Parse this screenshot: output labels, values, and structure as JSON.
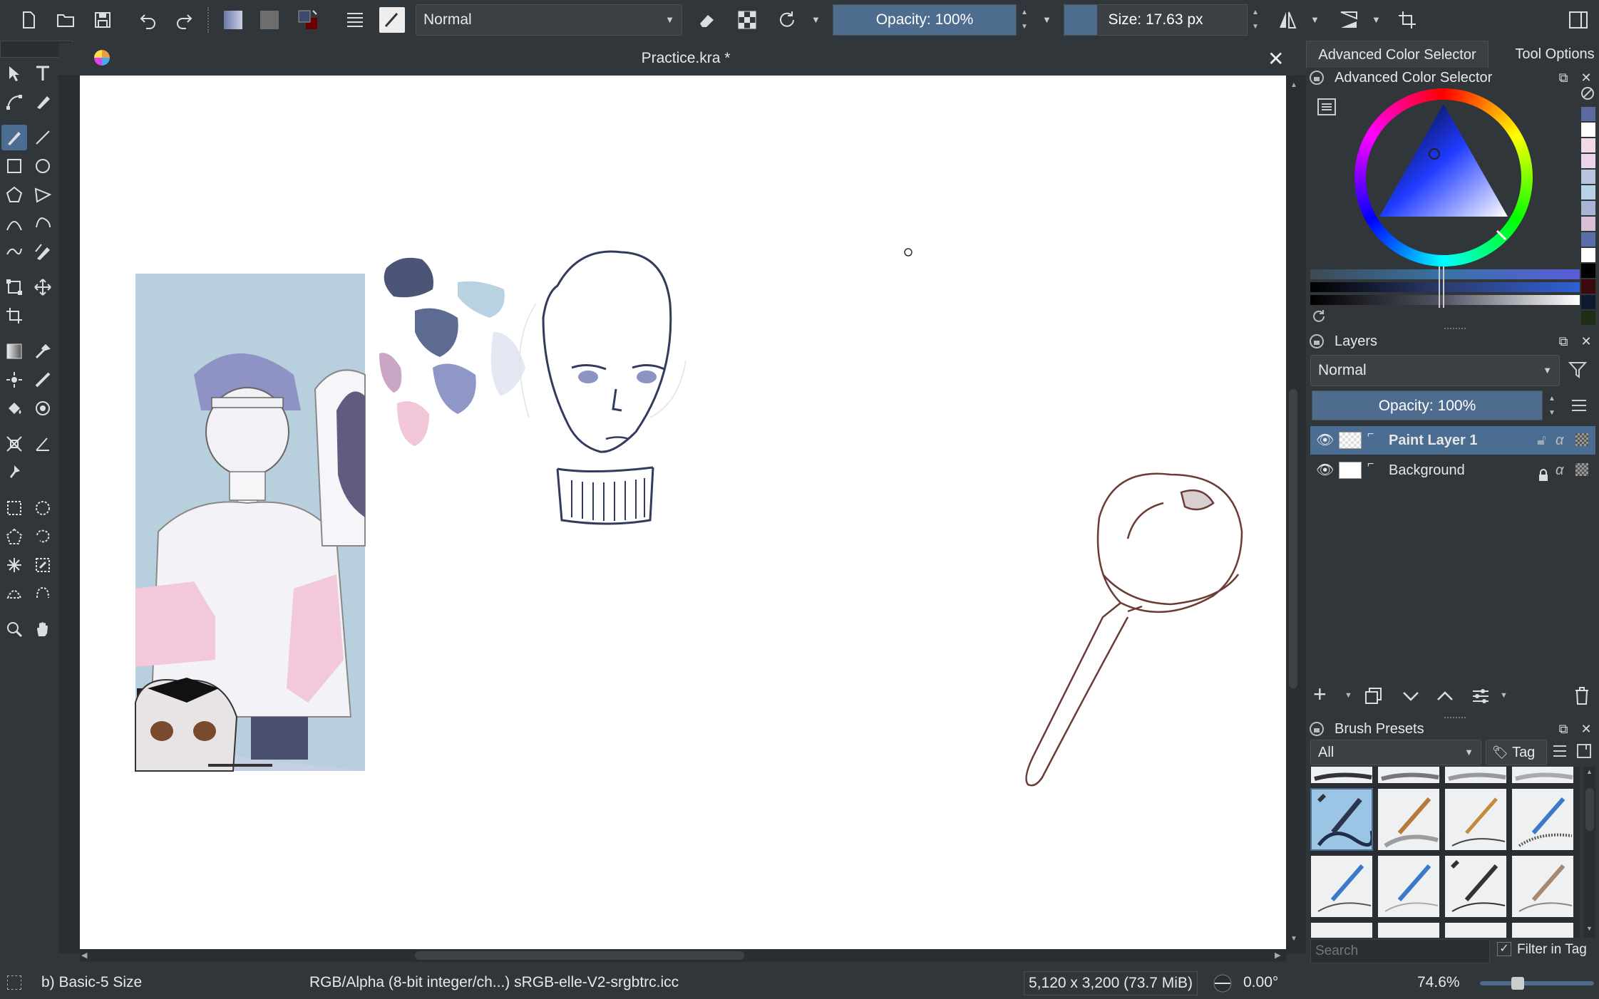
{
  "toolbar": {
    "blend_mode": "Normal",
    "opacity_label": "Opacity: 100%",
    "opacity_value": 1.0,
    "size_label": "Size: 17.63 px",
    "size_fill": 0.18
  },
  "document": {
    "title": "Practice.kra *"
  },
  "docker": {
    "tabs": [
      "Advanced Color Selector",
      "Tool Options"
    ],
    "color_selector_title": "Advanced Color Selector",
    "layers_title": "Layers",
    "layers_blend_mode": "Normal",
    "layers_opacity_label": "Opacity:  100%",
    "layers": [
      {
        "name": "Paint Layer 1",
        "selected": true,
        "locked": false
      },
      {
        "name": "Background",
        "selected": false,
        "locked": true
      }
    ],
    "brush_presets_title": "Brush Presets",
    "brush_filter": "All",
    "tag_label": "Tag",
    "search_placeholder": "Search",
    "filter_in_tag_label": "Filter in Tag",
    "filter_in_tag_checked": true
  },
  "status": {
    "brush_name": "b) Basic-5 Size",
    "color_space": "RGB/Alpha (8-bit integer/ch...)  sRGB-elle-V2-srgbtrc.icc",
    "dimensions": "5,120 x 3,200 (73.7 MiB)",
    "rotation": "0.00°",
    "zoom": "74.6%"
  },
  "colors": {
    "accent": "#4a6d91",
    "foreground_color": "#3d4a6b",
    "background_color": "#6b0000",
    "palette_swatches": [
      "#5b6a9a",
      "#ffffff",
      "#f2d9e6",
      "#ead6ee",
      "#b9c4de",
      "#b8d3e6",
      "#a9b5d6",
      "#d8bfd8",
      "#5a6ea8",
      "#ffffff",
      "#000000",
      "#3b0a0a",
      "#0e1a2e",
      "#1e2d14"
    ]
  }
}
